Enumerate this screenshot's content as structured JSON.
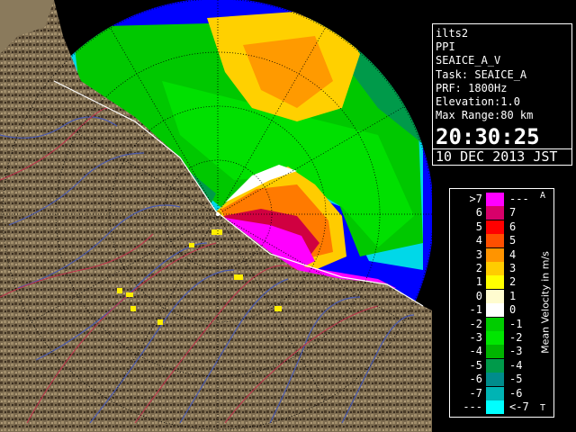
{
  "info": {
    "station": "ilts2",
    "product": "PPI",
    "task_name": "SEAICE_A_V",
    "task_line": "Task: SEAICE_A",
    "prf": "PRF: 1800Hz",
    "elevation": "Elevation:1.0",
    "max_range": "Max Range:80 km",
    "time": "20:30:25",
    "date": "10 DEC 2013 JST"
  },
  "legend": {
    "title": "Mean Velocity in m/s",
    "top_marker": "A",
    "bottom_marker": "T",
    "entries": [
      {
        "left": ">7",
        "right": "---",
        "color": "#ff00ff"
      },
      {
        "left": "6",
        "right": "7",
        "color": "#d8006a"
      },
      {
        "left": "5",
        "right": "6",
        "color": "#ff0000"
      },
      {
        "left": "4",
        "right": "5",
        "color": "#ff4f00"
      },
      {
        "left": "3",
        "right": "4",
        "color": "#ff9400"
      },
      {
        "left": "2",
        "right": "3",
        "color": "#ffcc00"
      },
      {
        "left": "1",
        "right": "2",
        "color": "#ffff00"
      },
      {
        "left": "0",
        "right": "1",
        "color": "#fffccf"
      },
      {
        "left": "-1",
        "right": "0",
        "color": "#ffffff"
      },
      {
        "left": "-2",
        "right": "-1",
        "color": "#00cc00"
      },
      {
        "left": "-3",
        "right": "-2",
        "color": "#00e600"
      },
      {
        "left": "-4",
        "right": "-3",
        "color": "#00b400"
      },
      {
        "left": "-5",
        "right": "-4",
        "color": "#009a4a"
      },
      {
        "left": "-6",
        "right": "-5",
        "color": "#008c8c"
      },
      {
        "left": "-7",
        "right": "-6",
        "color": "#00b4b4"
      },
      {
        "left": "---",
        "right": "<-7",
        "color": "#00ffff"
      }
    ]
  },
  "colors": {
    "land": "#7a6a4e",
    "land_dark": "#3f3324",
    "sea": "#0000ff",
    "river": "#4a5ab0",
    "border": "#c0304a"
  }
}
